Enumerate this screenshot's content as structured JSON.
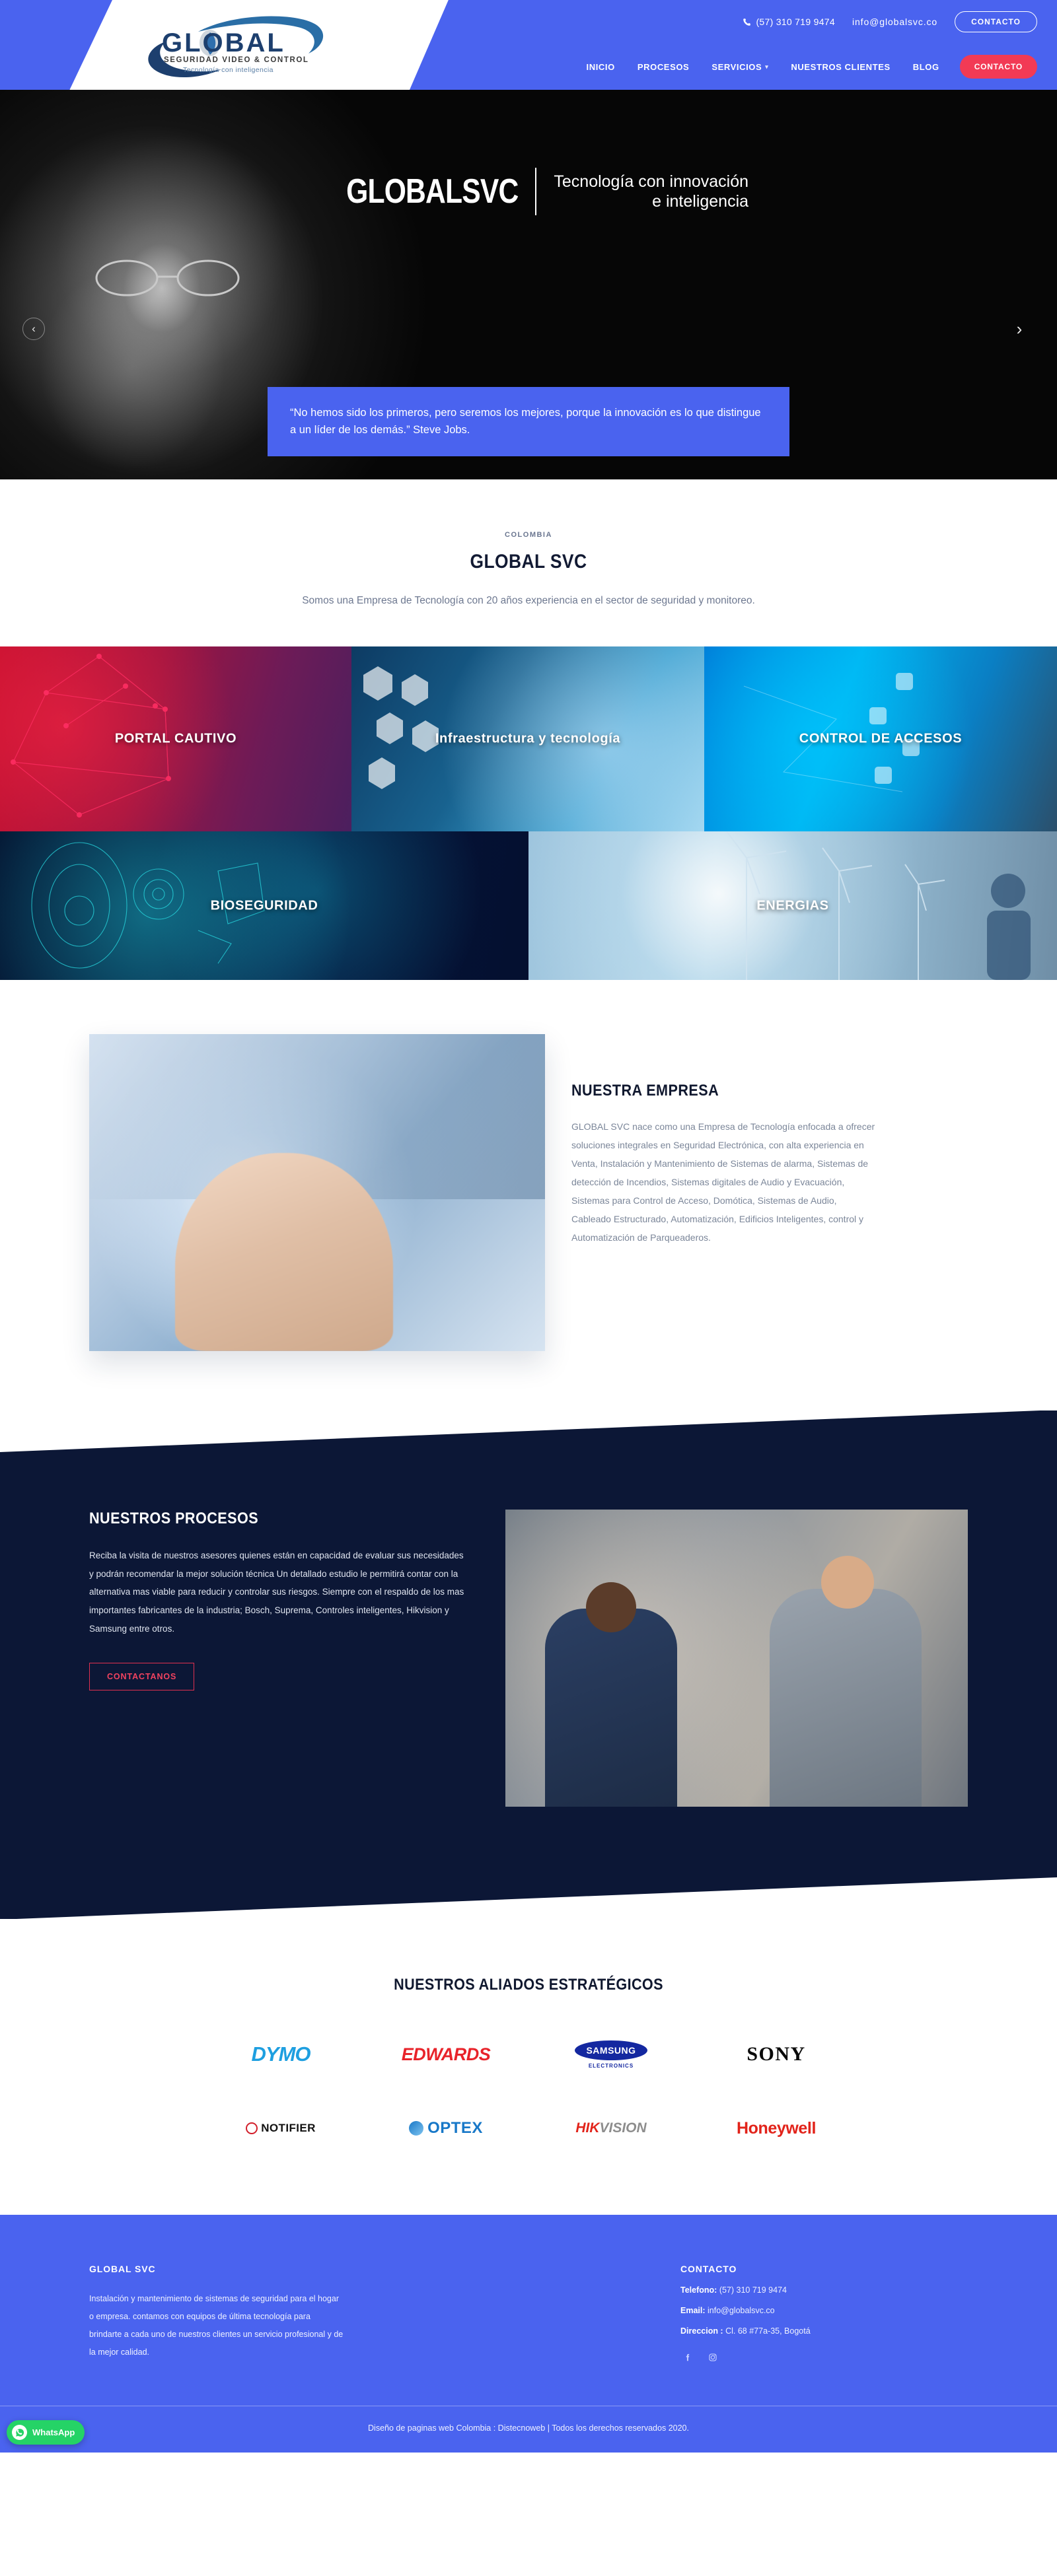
{
  "header": {
    "logo": {
      "word": "GLOBAL",
      "tagline1": "SEGURIDAD VIDEO & CONTROL",
      "tagline2": "Tecnología con inteligencia"
    },
    "topbar": {
      "phone_icon": "phone-icon",
      "phone": "(57) 310 719 9474",
      "email": "info@globalsvc.co",
      "contact_button": "CONTACTO"
    },
    "nav": {
      "items": [
        {
          "label": "INICIO",
          "has_dropdown": false
        },
        {
          "label": "PROCESOS",
          "has_dropdown": false
        },
        {
          "label": "SERVICIOS",
          "has_dropdown": true
        },
        {
          "label": "NUESTROS CLIENTES",
          "has_dropdown": false
        },
        {
          "label": "BLOG",
          "has_dropdown": false
        }
      ],
      "cta_label": "CONTACTO",
      "cta_color": "#f23a55"
    }
  },
  "hero": {
    "title": "GLOBALSVC",
    "subtitle_line1": "Tecnología con innovación",
    "subtitle_line2": "e inteligencia",
    "quote": "“No hemos sido los primeros, pero seremos los mejores, porque la innovación es lo que distingue a un líder de los demás.” Steve Jobs.",
    "prev_arrow": "‹",
    "next_arrow": "›",
    "quote_bg": "#4a63ef"
  },
  "intro": {
    "eyebrow": "COLOMBIA",
    "title": "GLOBAL SVC",
    "description": "Somos una Empresa de Tecnología con 20 años experiencia en el sector de seguridad y monitoreo."
  },
  "tiles": {
    "row1": [
      {
        "label": "PORTAL CAUTIVO",
        "theme": "t-portal"
      },
      {
        "label": "Infraestructura y tecnología",
        "theme": "t-infra"
      },
      {
        "label": "CONTROL DE ACCESOS",
        "theme": "t-acceso"
      }
    ],
    "row2": [
      {
        "label": "BIOSEGURIDAD",
        "theme": "t-bio"
      },
      {
        "label": "ENERGIAS",
        "theme": "t-energ"
      }
    ]
  },
  "empresa": {
    "title": "NUESTRA EMPRESA",
    "body": "GLOBAL SVC nace como una Empresa de Tecnología enfocada a ofrecer soluciones integrales en Seguridad Electrónica, con alta experiencia en Venta, Instalación y Mantenimiento de Sistemas de alarma, Sistemas de detección de Incendios, Sistemas digitales de Audio y Evacuación, Sistemas para Control de Acceso, Domótica, Sistemas de Audio, Cableado Estructurado, Automatización, Edificios Inteligentes, control y Automatización de Parqueaderos."
  },
  "procesos": {
    "title": "NUESTROS PROCESOS",
    "body": "Reciba la visita de nuestros asesores quienes están en capacidad de evaluar sus necesidades y podrán recomendar la mejor solución técnica\nUn detallado estudio le permitirá contar con la alternativa mas viable para reducir y controlar sus riesgos. Siempre con el respaldo de los mas importantes fabricantes de la industria; Bosch, Suprema, Controles inteligentes, Hikvision y Samsung entre otros.",
    "button": "CONTACTANOS",
    "button_color": "#f1425f",
    "bg": "#0c1736"
  },
  "aliados": {
    "title": "NUESTROS ALIADOS ESTRATÉGICOS",
    "row1": [
      {
        "name": "DYMO",
        "color": "#1e9fe0"
      },
      {
        "name": "EDWARDS",
        "color": "#e8232a"
      },
      {
        "name": "SAMSUNG",
        "sub": "ELECTRONICS",
        "color": "#1428a0"
      },
      {
        "name": "SONY",
        "color": "#0a0a0a"
      }
    ],
    "row2": [
      {
        "name": "NOTIFIER",
        "color": "#111111"
      },
      {
        "name": "OPTEX",
        "color": "#1878c8"
      },
      {
        "name_a": "HIK",
        "name_b": "VISION",
        "color": "#e2231a"
      },
      {
        "name": "Honeywell",
        "color": "#e2231a"
      }
    ]
  },
  "footer": {
    "brand_title": "GLOBAL SVC",
    "brand_text": "Instalación y mantenimiento de sistemas de seguridad para el hogar o empresa. contamos con equipos de última tecnología para brindarte a cada uno de nuestros clientes un servicio profesional y de la mejor calidad.",
    "contact_title": "CONTACTO",
    "phone_label": "Telefono:",
    "phone_value": "(57) 310 719 9474",
    "email_label": "Email:",
    "email_value": "info@globalsvc.co",
    "address_label": "Direccion :",
    "address_value": "Cl. 68 #77a-35, Bogotá",
    "social": [
      {
        "icon": "facebook-icon",
        "glyph": "f"
      },
      {
        "icon": "instagram-icon",
        "glyph": "▢"
      }
    ],
    "copyright": "Diseño de paginas web Colombia : Distecnoweb | Todos los derechos reservados 2020.",
    "bg": "#4a63ef"
  },
  "whatsapp": {
    "label": "WhatsApp",
    "glyph": "✆",
    "color": "#25d366"
  }
}
